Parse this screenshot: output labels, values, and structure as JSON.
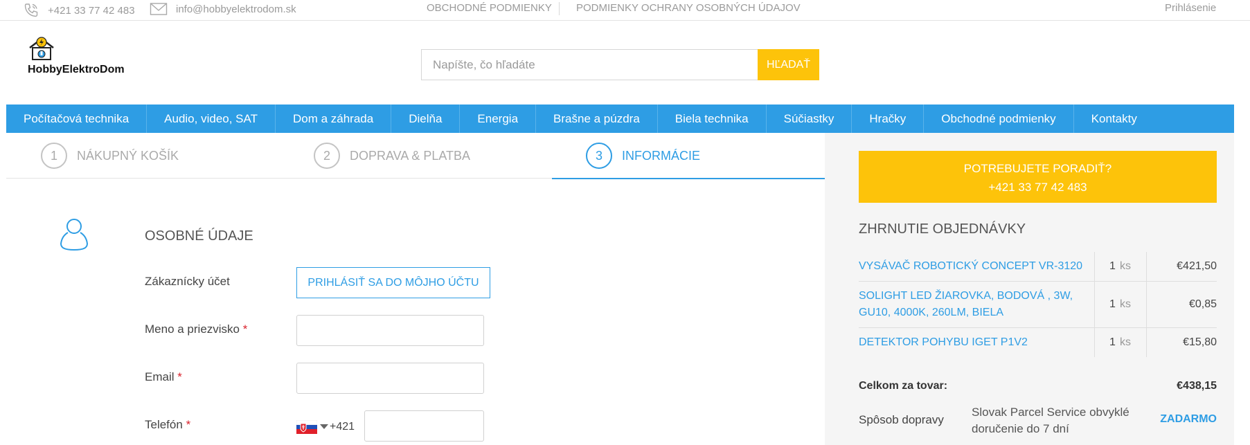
{
  "topbar": {
    "phone": "+421 33 77 42 483",
    "email": "info@hobbyelektrodom.sk",
    "terms_link": "OBCHODNÉ PODMIENKY",
    "privacy_link": "PODMIENKY OCHRANY OSOBNÝCH ÚDAJOV",
    "login_link": "Prihlásenie",
    "phone_icon": "phone-icon",
    "email_icon": "envelope-icon"
  },
  "header": {
    "logo_text": "HobbyElektroDom",
    "search_placeholder": "Napíšte, čo hľadáte",
    "search_button": "HĽADAŤ"
  },
  "nav": {
    "items": [
      "Počítačová technika",
      "Audio, video, SAT",
      "Dom a záhrada",
      "Dielňa",
      "Energia",
      "Brašne a púzdra",
      "Biela technika",
      "Súčiastky",
      "Hračky",
      "Obchodné podmienky",
      "Kontakty"
    ]
  },
  "checkout": {
    "steps": [
      {
        "num": "1",
        "label": "NÁKUPNÝ KOŠÍK",
        "active": false
      },
      {
        "num": "2",
        "label": "DOPRAVA & PLATBA",
        "active": false
      },
      {
        "num": "3",
        "label": "INFORMÁCIE",
        "active": true
      }
    ],
    "section_title": "OSOBNÉ ÚDAJE",
    "section_icon": "user-icon",
    "account_label": "Zákaznícky účet",
    "login_button": "PRIHLÁSIŤ SA DO MÔJHO ÚČTU",
    "name_label": "Meno a priezvisko",
    "email_label": "Email",
    "phone_label": "Telefón",
    "required_mark": "*",
    "name_value": "",
    "email_value": "",
    "phone_value": "",
    "phone_prefix": "+421",
    "phone_country_icon": "slovakia-flag-icon"
  },
  "sidebar": {
    "help_line1": "POTREBUJETE PORADIŤ?",
    "help_line2": "+421 33 77 42 483",
    "summary_title": "ZHRNUTIE OBJEDNÁVKY",
    "items": [
      {
        "name": "VYSÁVAČ ROBOTICKÝ CONCEPT VR-3120",
        "qty": "1",
        "unit": "ks",
        "price": "€421,50"
      },
      {
        "name": "SOLIGHT LED ŽIAROVKA, BODOVÁ , 3W, GU10, 4000K, 260LM, BIELA",
        "qty": "1",
        "unit": "ks",
        "price": "€0,85"
      },
      {
        "name": "DETEKTOR POHYBU IGET P1V2",
        "qty": "1",
        "unit": "ks",
        "price": "€15,80"
      }
    ],
    "total_label": "Celkom za tovar:",
    "total_value": "€438,15",
    "shipping_label": "Spôsob dopravy",
    "shipping_value": "Slovak Parcel Service obvyklé doručenie do 7 dní",
    "shipping_price": "ZADARMO"
  },
  "colors": {
    "accent": "#2e9de4",
    "highlight": "#fdc30a",
    "required": "#d9232d"
  }
}
